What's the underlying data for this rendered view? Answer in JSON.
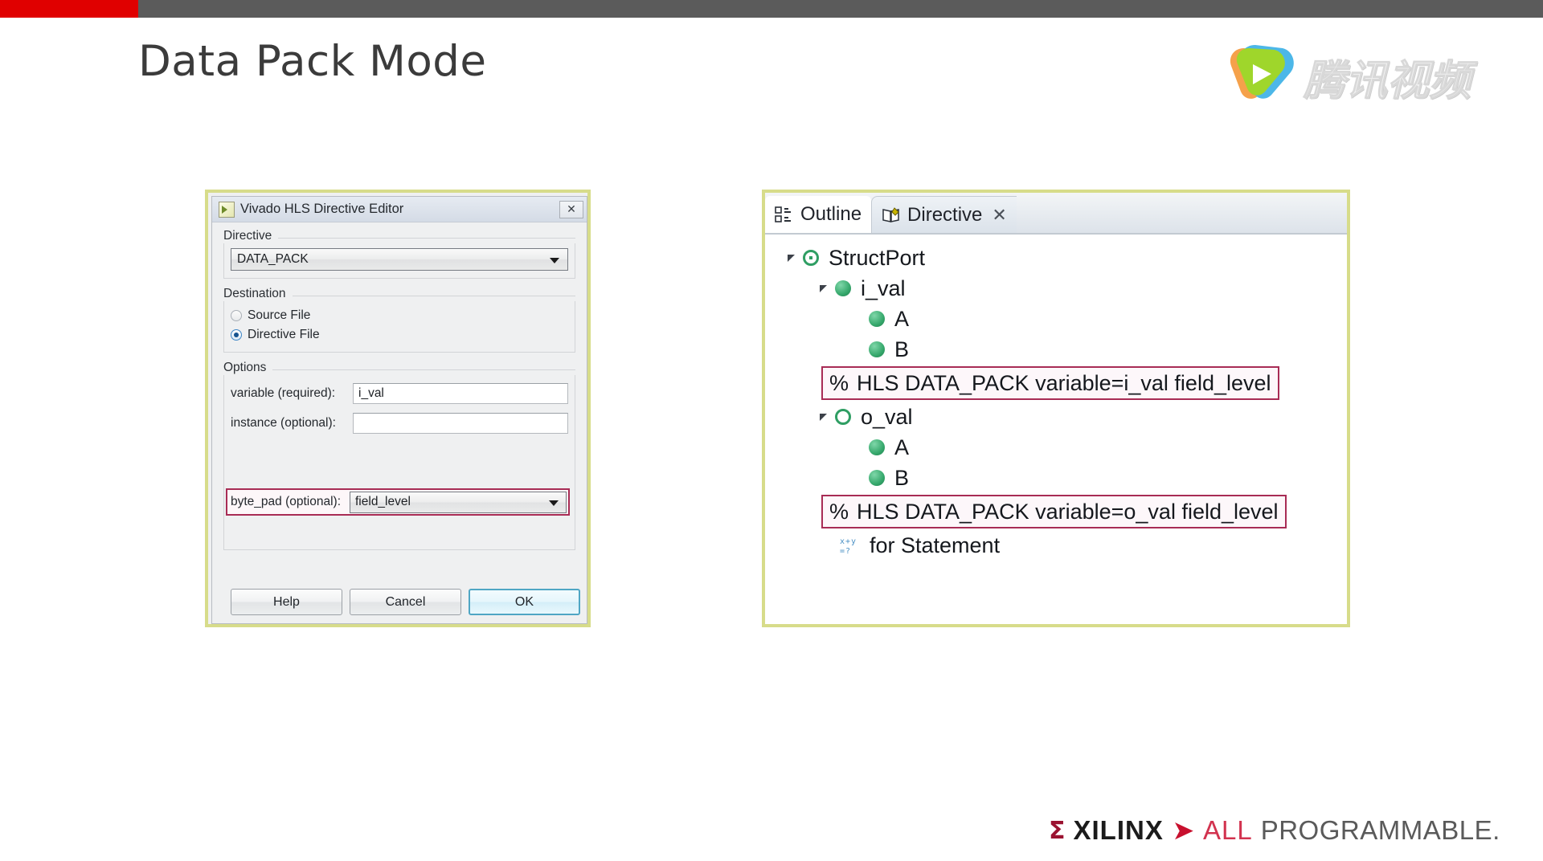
{
  "topbar": {
    "accent_color": "#e00000",
    "bar_color": "#5b5b5b"
  },
  "slide": {
    "title": "Data Pack Mode"
  },
  "watermark": {
    "brand_text": "腾讯视频",
    "mark_name": "tencent-video-play-mark"
  },
  "dialog": {
    "icon_name": "vivado-app-icon",
    "title": "Vivado HLS Directive Editor",
    "close_label": "✕",
    "directive": {
      "group_label": "Directive",
      "selected": "DATA_PACK"
    },
    "destination": {
      "group_label": "Destination",
      "options": [
        {
          "label": "Source File",
          "selected": false
        },
        {
          "label": "Directive File",
          "selected": true
        }
      ]
    },
    "options": {
      "group_label": "Options",
      "fields": [
        {
          "label": "variable (required):",
          "value": "i_val",
          "type": "text",
          "highlighted": false
        },
        {
          "label": "instance (optional):",
          "value": "",
          "type": "text",
          "highlighted": false
        },
        {
          "label": "byte_pad (optional):",
          "value": "field_level",
          "type": "combo",
          "highlighted": true
        }
      ]
    },
    "buttons": {
      "help": "Help",
      "cancel": "Cancel",
      "ok": "OK"
    },
    "highlight_color": "#a82c55",
    "outer_border_color": "#d7dc8a"
  },
  "view": {
    "outer_border_color": "#d7dc8a",
    "tabs": [
      {
        "label": "Outline",
        "icon": "outline-icon",
        "active": false,
        "closable": false
      },
      {
        "label": "Directive",
        "icon": "directive-book-icon",
        "active": true,
        "closable": true,
        "close_label": "✕"
      }
    ],
    "tree": [
      {
        "indent": 0,
        "twisty": true,
        "marker": "ring-out",
        "label": "StructPort",
        "kind": "node"
      },
      {
        "indent": 1,
        "twisty": true,
        "marker": "dot",
        "label": "i_val",
        "kind": "node"
      },
      {
        "indent": 2,
        "twisty": false,
        "marker": "dot",
        "label": "A",
        "kind": "node"
      },
      {
        "indent": 2,
        "twisty": false,
        "marker": "dot",
        "label": "B",
        "kind": "node"
      },
      {
        "indent": 2,
        "twisty": false,
        "marker": "none",
        "label": "HLS DATA_PACK variable=i_val field_level",
        "prefix": "%",
        "kind": "pragma"
      },
      {
        "indent": 1,
        "twisty": true,
        "marker": "ring",
        "label": "o_val",
        "kind": "node"
      },
      {
        "indent": 2,
        "twisty": false,
        "marker": "dot",
        "label": "A",
        "kind": "node"
      },
      {
        "indent": 2,
        "twisty": false,
        "marker": "dot",
        "label": "B",
        "kind": "node"
      },
      {
        "indent": 2,
        "twisty": false,
        "marker": "none",
        "label": "HLS DATA_PACK variable=o_val field_level",
        "prefix": "%",
        "kind": "pragma"
      },
      {
        "indent": 2,
        "twisty": false,
        "marker": "for",
        "label": "for Statement",
        "kind": "node"
      }
    ]
  },
  "footer": {
    "mark": "Σ",
    "brand": "XILINX",
    "chevron": "➤",
    "all": "ALL",
    "programmable": "PROGRAMMABLE."
  }
}
